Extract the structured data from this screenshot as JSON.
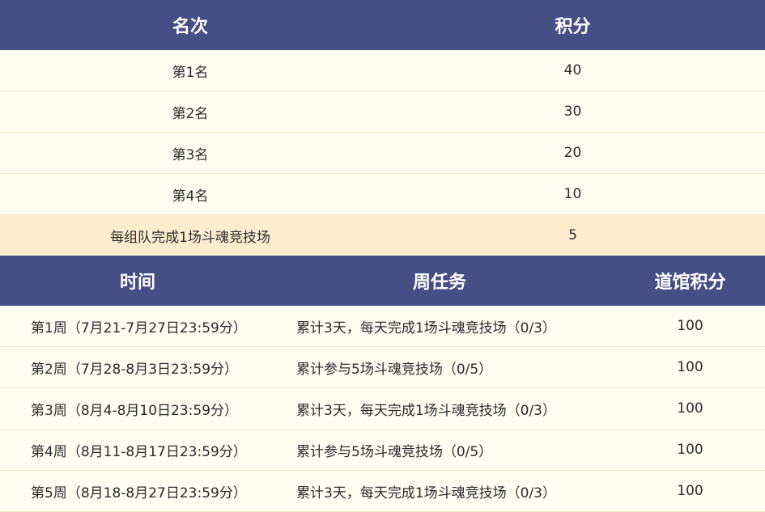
{
  "rank_table": {
    "headers": [
      "名次",
      "积分"
    ],
    "rows": [
      {
        "rank": "第1名",
        "points": "40"
      },
      {
        "rank": "第2名",
        "points": "30"
      },
      {
        "rank": "第3名",
        "points": "20"
      },
      {
        "rank": "第4名",
        "points": "10"
      },
      {
        "rank": "每组队完成1场斗魂竞技场",
        "points": "5"
      }
    ]
  },
  "weekly_table": {
    "headers": [
      "时间",
      "周任务",
      "道馆积分"
    ],
    "rows": [
      {
        "time": "第1周（7月21-7月27日23:59分）",
        "task": "累计3天，每天完成1场斗魂竞技场（0/3）",
        "points": "100"
      },
      {
        "time": "第2周（7月28-8月3日23:59分）",
        "task": "累计参与5场斗魂竞技场（0/5）",
        "points": "100"
      },
      {
        "time": "第3周（8月4-8月10日23:59分）",
        "task": "累计3天，每天完成1场斗魂竞技场（0/3）",
        "points": "100"
      },
      {
        "time": "第4周（8月11-8月17日23:59分）",
        "task": "累计参与5场斗魂竞技场（0/5）",
        "points": "100"
      },
      {
        "time": "第5周（8月18-8月27日23:59分）",
        "task": "累计3天，每天完成1场斗魂竞技场（0/3）",
        "points": "100"
      }
    ]
  },
  "colors": {
    "header_bg": "#454f85",
    "row_bg": "#fffdf0",
    "highlight_bg": "#fdedcf"
  }
}
